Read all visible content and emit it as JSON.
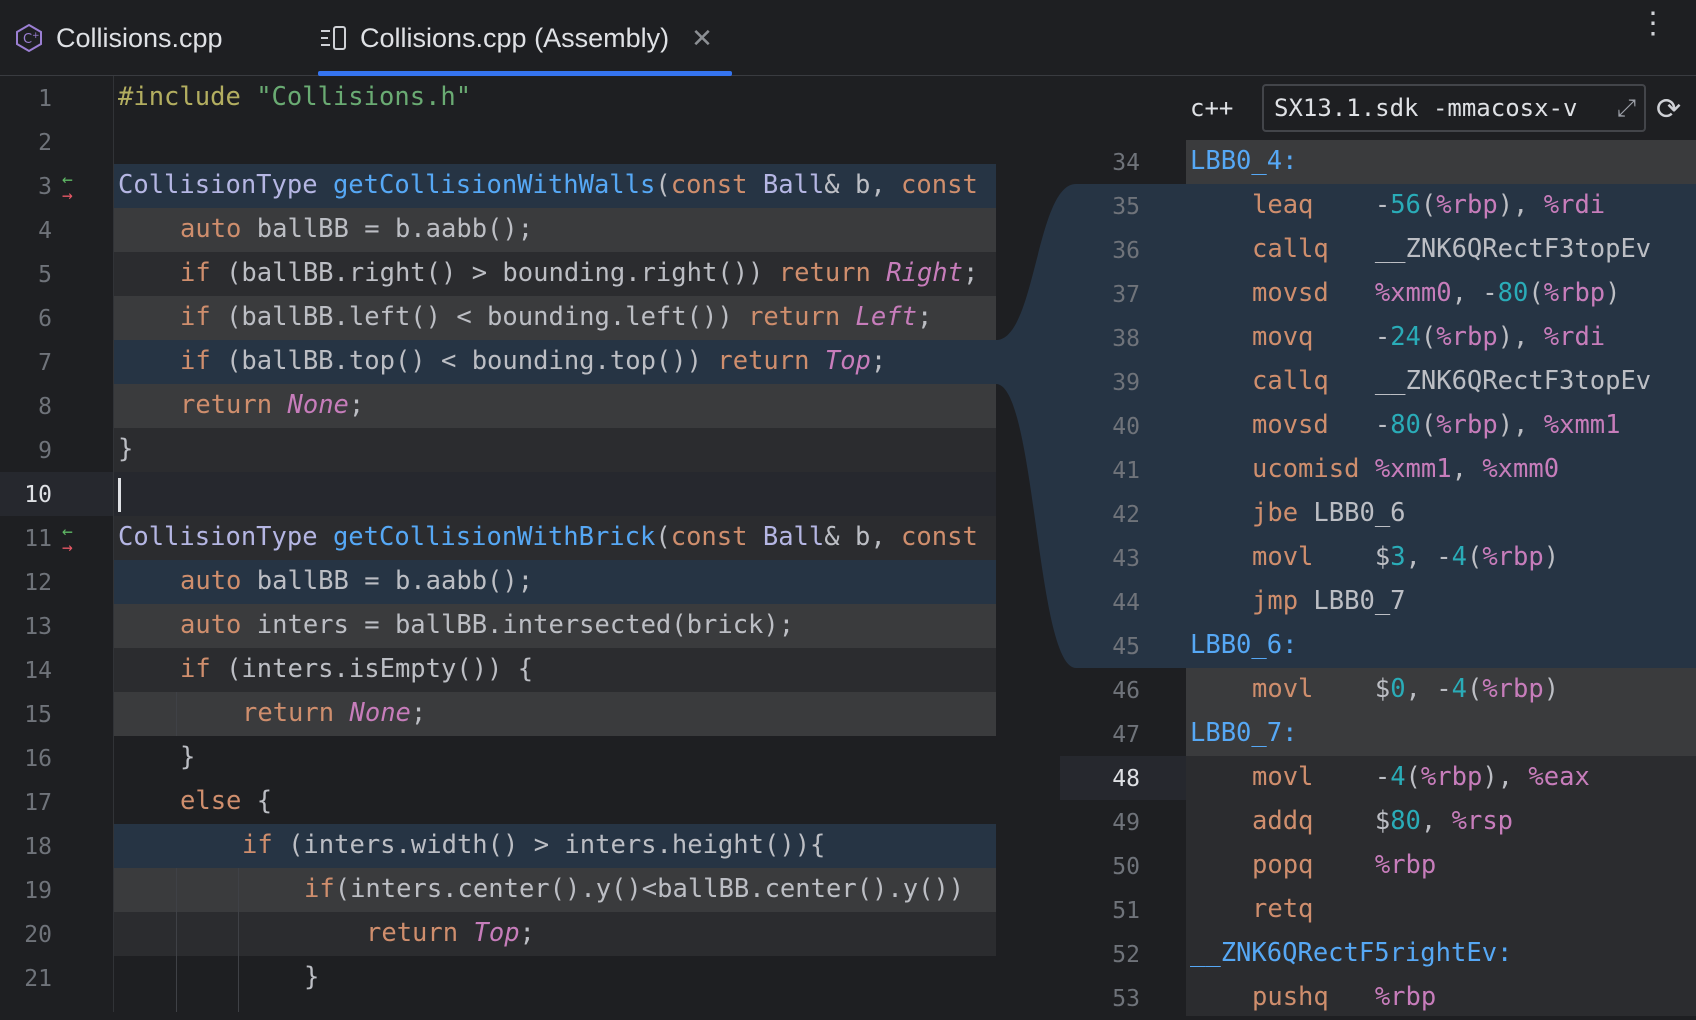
{
  "tabs": [
    {
      "label": "Collisions.cpp",
      "icon": "cpp-file-icon"
    },
    {
      "label": "Collisions.cpp (Assembly)",
      "icon": "assembly-file-icon",
      "active": true
    }
  ],
  "toolbar": {
    "lang": "c++",
    "flags": "SX13.1.sdk -mmacosx-v"
  },
  "source": {
    "line_numbers": [
      "1",
      "2",
      "3",
      "4",
      "5",
      "6",
      "7",
      "8",
      "9",
      "10",
      "11",
      "12",
      "13",
      "14",
      "15",
      "16",
      "17",
      "18",
      "19",
      "20",
      "21"
    ],
    "current_line": "10"
  },
  "assembly": {
    "line_numbers": [
      "34",
      "35",
      "36",
      "37",
      "38",
      "39",
      "40",
      "41",
      "42",
      "43",
      "44",
      "45",
      "46",
      "47",
      "48",
      "49",
      "50",
      "51",
      "52",
      "53"
    ],
    "current_line": "48"
  },
  "colors": {
    "accent": "#3574f0",
    "highlight_blue": "#263444",
    "highlight_gray": "#3a3b3d"
  }
}
